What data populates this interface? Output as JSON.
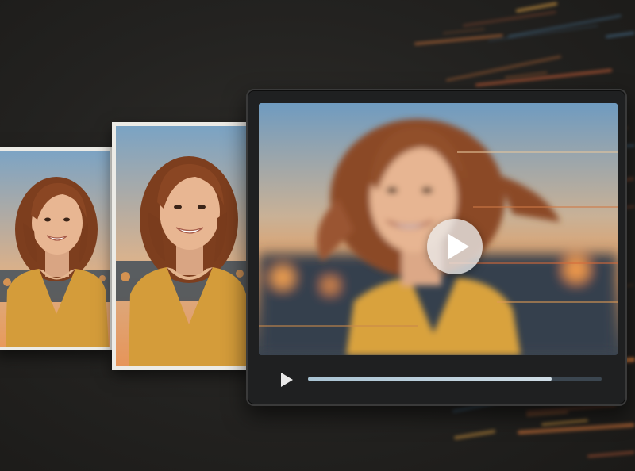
{
  "scene": {
    "background": "#232220",
    "accent_streak_colors": [
      "#d9653a",
      "#e07b3c",
      "#4e7fa6",
      "#c9913e"
    ]
  },
  "photos": [
    {
      "name": "small-photo"
    },
    {
      "name": "medium-photo"
    }
  ],
  "player": {
    "play_overlay_icon": "play-icon",
    "control_play_icon": "play-icon",
    "progress": 0.83
  },
  "colors": {
    "shirt": "#d9a23c",
    "hair": "#8a4a25",
    "skin": "#e6b48f",
    "sky_top": "#7fa6c6",
    "sky_bottom": "#f0b07a"
  }
}
